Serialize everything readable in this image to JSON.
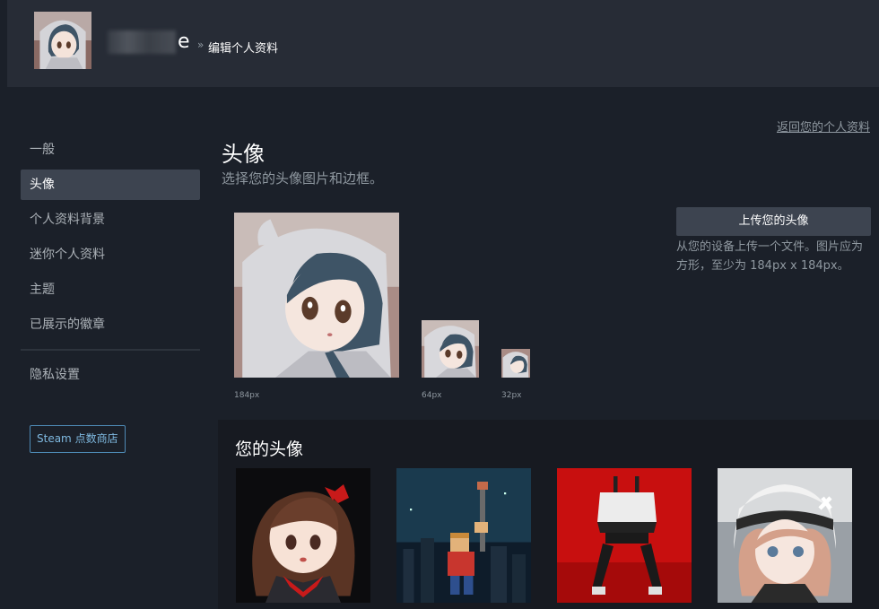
{
  "header": {
    "username_visible_tail": "e",
    "breadcrumb_separator": "»",
    "breadcrumb": "编辑个人资料"
  },
  "back_link": "返回您的个人资料",
  "nav": {
    "items": [
      {
        "label": "一般",
        "active": false
      },
      {
        "label": "头像",
        "active": true
      },
      {
        "label": "个人资料背景",
        "active": false
      },
      {
        "label": "迷你个人资料",
        "active": false
      },
      {
        "label": "主题",
        "active": false
      },
      {
        "label": "已展示的徽章",
        "active": false
      }
    ],
    "privacy": "隐私设置",
    "store_button": "Steam 点数商店"
  },
  "avatar_section": {
    "title": "头像",
    "subtitle": "选择您的头像图片和边框。",
    "sizes": [
      "184px",
      "64px",
      "32px"
    ],
    "upload_button": "上传您的头像",
    "upload_desc": "从您的设备上传一个文件。图片应为方形，至少为 184px x 184px。"
  },
  "your_avatars": {
    "title": "您的头像",
    "tiles": [
      {
        "icon": "anime-girl-red-bow-avatar"
      },
      {
        "icon": "pixel-soldier-avatar"
      },
      {
        "icon": "mech-robot-red-avatar"
      },
      {
        "icon": "anime-girl-white-hood-avatar"
      }
    ]
  },
  "colors": {
    "background": "#1b2029",
    "header": "#272c36",
    "active_nav": "#3d4450",
    "panel": "#171a21",
    "link_blue": "#7fb9e0"
  }
}
